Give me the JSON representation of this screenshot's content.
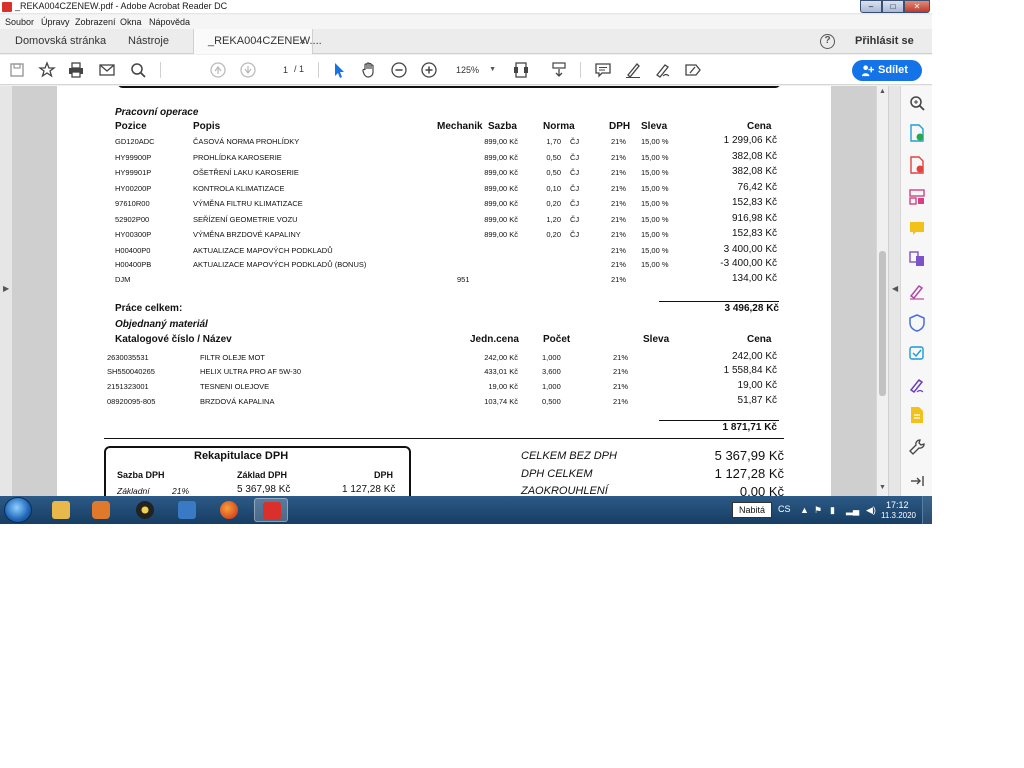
{
  "window": {
    "title": "_REKA004CZENEW.pdf - Adobe Acrobat Reader DC",
    "minimize": "–",
    "maximize": "□",
    "close": "✕"
  },
  "menu": [
    "Soubor",
    "Úpravy",
    "Zobrazení",
    "Okna",
    "Nápověda"
  ],
  "tabs": {
    "home": "Domovská stránka",
    "tools": "Nástroje",
    "document": "_REKA004CZENEW....",
    "close": "×"
  },
  "header": {
    "help": "?",
    "signin": "Přihlásit se"
  },
  "toolbar": {
    "page_current": "1",
    "page_total": "/ 1",
    "zoom": "125%",
    "share": "Sdílet"
  },
  "document": {
    "operations": {
      "section": "Pracovní operace",
      "headers": {
        "pozice": "Pozice",
        "popis": "Popis",
        "mechanik": "Mechanik",
        "sazba": "Sazba",
        "norma": "Norma",
        "dph": "DPH",
        "sleva": "Sleva",
        "cena": "Cena"
      },
      "rows": [
        {
          "code": "GD120ADC",
          "desc": "ČASOVÁ NORMA PROHLÍDKY",
          "mech": "",
          "sazba": "899,00 Kč",
          "norma": "1,70",
          "unit": "ČJ",
          "dph": "21%",
          "sleva": "15,00 %",
          "cena": "1 299,06 Kč"
        },
        {
          "code": "HY99900P",
          "desc": "PROHLÍDKA KAROSERIE",
          "mech": "",
          "sazba": "899,00 Kč",
          "norma": "0,50",
          "unit": "ČJ",
          "dph": "21%",
          "sleva": "15,00 %",
          "cena": "382,08 Kč"
        },
        {
          "code": "HY99901P",
          "desc": "OŠETŘENÍ LAKU KAROSERIE",
          "mech": "",
          "sazba": "899,00 Kč",
          "norma": "0,50",
          "unit": "ČJ",
          "dph": "21%",
          "sleva": "15,00 %",
          "cena": "382,08 Kč"
        },
        {
          "code": "HY00200P",
          "desc": "KONTROLA  KLIMATIZACE",
          "mech": "",
          "sazba": "899,00 Kč",
          "norma": "0,10",
          "unit": "ČJ",
          "dph": "21%",
          "sleva": "15,00 %",
          "cena": "76,42 Kč"
        },
        {
          "code": "97610R00",
          "desc": "VÝMĚNA FILTRU KLIMATIZACE",
          "mech": "",
          "sazba": "899,00 Kč",
          "norma": "0,20",
          "unit": "ČJ",
          "dph": "21%",
          "sleva": "15,00 %",
          "cena": "152,83 Kč"
        },
        {
          "code": "52902P00",
          "desc": "SEŘÍZENÍ GEOMETRIE VOZU",
          "mech": "",
          "sazba": "899,00 Kč",
          "norma": "1,20",
          "unit": "ČJ",
          "dph": "21%",
          "sleva": "15,00 %",
          "cena": "916,98 Kč"
        },
        {
          "code": "HY00300P",
          "desc": "VÝMĚNA BRZDOVÉ KAPALINY",
          "mech": "",
          "sazba": "899,00 Kč",
          "norma": "0,20",
          "unit": "ČJ",
          "dph": "21%",
          "sleva": "15,00 %",
          "cena": "152,83 Kč"
        },
        {
          "code": "H00400P0",
          "desc": "AKTUALIZACE MAPOVÝCH PODKLADŮ",
          "mech": "",
          "sazba": "",
          "norma": "",
          "unit": "",
          "dph": "21%",
          "sleva": "15,00 %",
          "cena": "3 400,00 Kč"
        },
        {
          "code": "H00400PB",
          "desc": "AKTUALIZACE MAPOVÝCH PODKLADŮ (BONUS)",
          "mech": "",
          "sazba": "",
          "norma": "",
          "unit": "",
          "dph": "21%",
          "sleva": "15,00 %",
          "cena": "-3 400,00 Kč"
        },
        {
          "code": "DJM",
          "desc": "",
          "mech": "951",
          "sazba": "",
          "norma": "",
          "unit": "",
          "dph": "21%",
          "sleva": "",
          "cena": "134,00 Kč"
        }
      ],
      "total_label": "Práce celkem:",
      "total_value": "3 496,28 Kč"
    },
    "materials": {
      "section": "Objednaný materiál",
      "headers": {
        "katalog": "Katalogové číslo / Název",
        "jedn": "Jedn.cena",
        "pocet": "Počet",
        "sleva": "Sleva",
        "cena": "Cena"
      },
      "rows": [
        {
          "code": "2630035531",
          "name": "FILTR OLEJE MOT",
          "price": "242,00 Kč",
          "qty": "1,000",
          "dph": "21%",
          "cena": "242,00 Kč"
        },
        {
          "code": "SH550040265",
          "name": "HELIX ULTRA PRO AF 5W-30",
          "price": "433,01 Kč",
          "qty": "3,600",
          "dph": "21%",
          "cena": "1 558,84 Kč"
        },
        {
          "code": "2151323001",
          "name": "TESNENI OLEJOVE",
          "price": "19,00 Kč",
          "qty": "1,000",
          "dph": "21%",
          "cena": "19,00 Kč"
        },
        {
          "code": "08920095-805",
          "name": "BRZDOVÁ KAPALINA",
          "price": "103,74 Kč",
          "qty": "0,500",
          "dph": "21%",
          "cena": "51,87 Kč"
        }
      ],
      "total_value": "1 871,71 Kč"
    },
    "recap": {
      "title": "Rekapitulace DPH",
      "h_sazba": "Sazba DPH",
      "h_zaklad": "Základ DPH",
      "h_dph": "DPH",
      "row_label": "Základní",
      "row_rate": "21%",
      "row_zaklad": "5 367,98 Kč",
      "row_dph": "1 127,28 Kč"
    },
    "summary": [
      {
        "label": "CELKEM BEZ DPH",
        "value": "5 367,99 Kč"
      },
      {
        "label": "DPH CELKEM",
        "value": "1 127,28 Kč"
      },
      {
        "label": "ZAOKROUHLENÍ",
        "value": "0,00 Kč"
      }
    ]
  },
  "taskbar": {
    "tooltip": "Nabitá",
    "lang": "CS",
    "time": "17:12",
    "date": "11.3.2020"
  },
  "colors": {
    "accent": "#1473e6",
    "taskbar": "#1f4a73",
    "pdf_red": "#d9302c"
  }
}
